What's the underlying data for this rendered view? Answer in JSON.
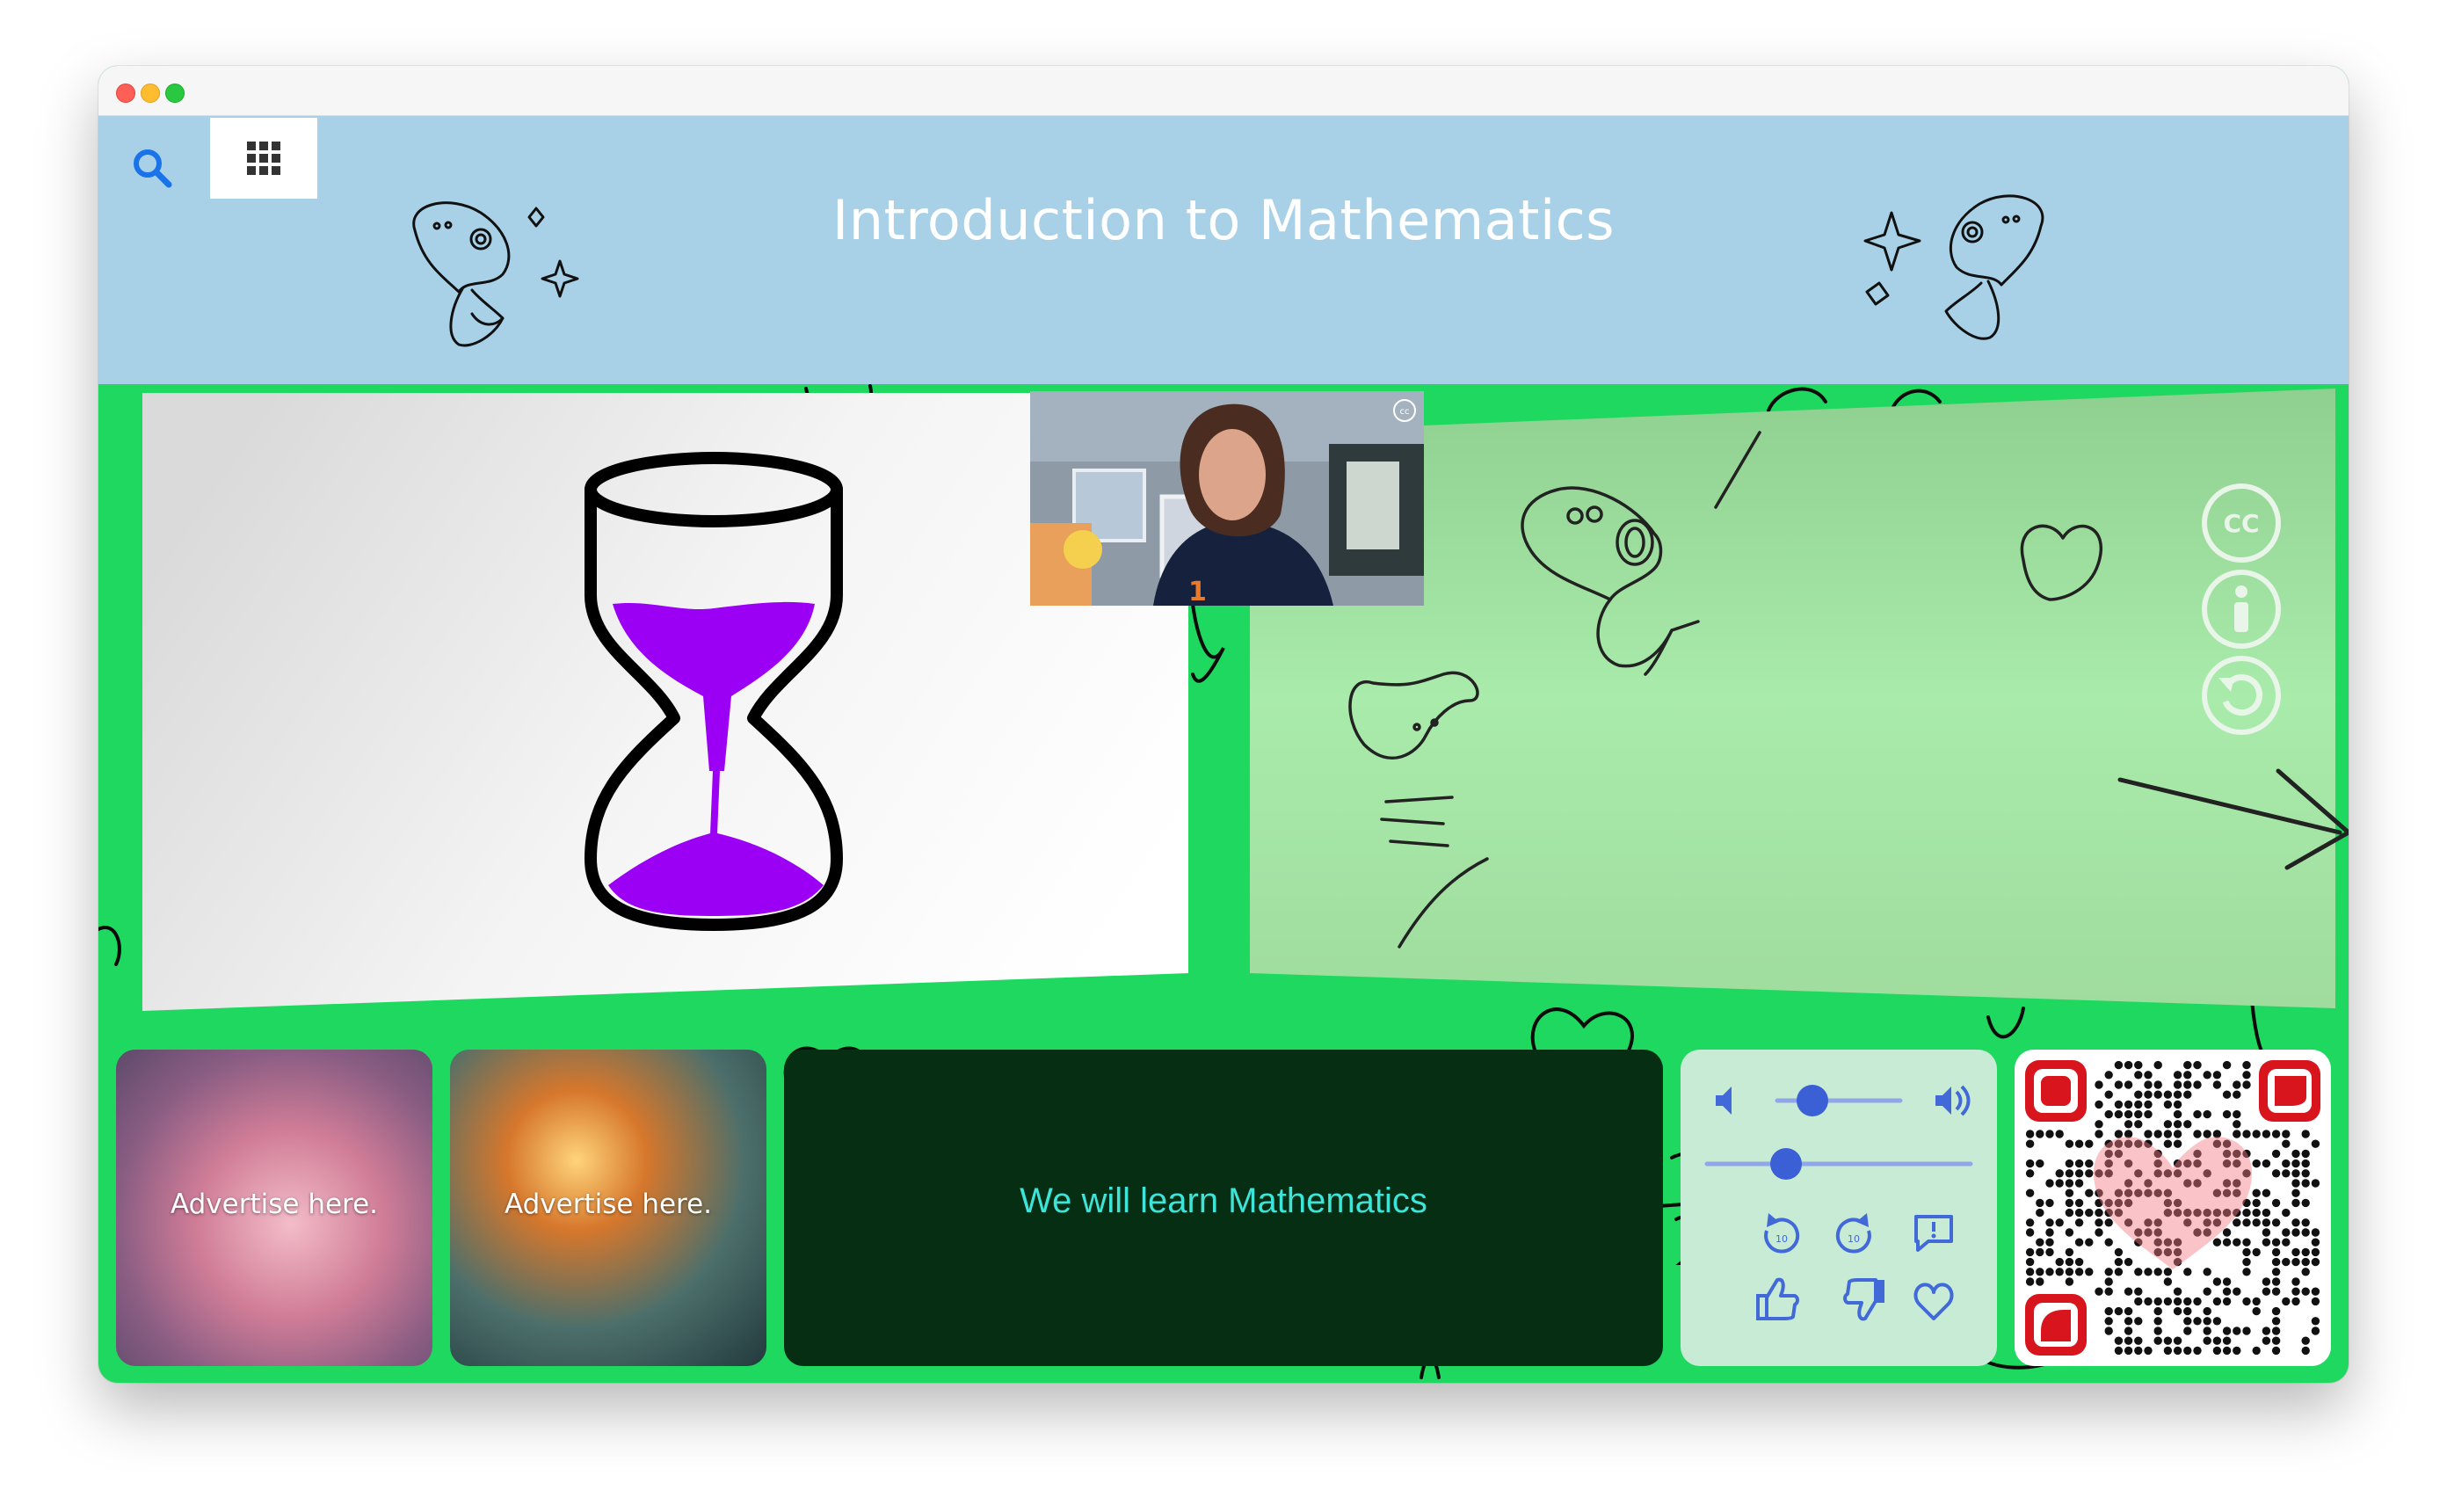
{
  "header": {
    "title": "Introduction to Mathematics"
  },
  "message": {
    "text": "We will learn Mathematics"
  },
  "ads": [
    {
      "label": "Advertise here."
    },
    {
      "label": "Advertise here."
    }
  ],
  "video": {
    "cc_badge": "cc"
  },
  "side_controls": {
    "cc_label": "CC"
  },
  "colors": {
    "stage_background": "#1fd860",
    "header_background": "#a8d1e7",
    "hourglass_sand": "#9b00f5",
    "message_background": "#062e13",
    "message_text": "#3ee4d8",
    "controls_accent": "#4169d8",
    "qr_accent": "#d8141d"
  },
  "icons": [
    "search-icon",
    "apps-grid-icon",
    "closed-captions-icon",
    "info-icon",
    "replay-icon",
    "volume-low-icon",
    "volume-high-icon",
    "rewind-10-icon",
    "forward-10-icon",
    "feedback-icon",
    "thumbs-up-icon",
    "thumbs-down-icon",
    "heart-icon"
  ]
}
